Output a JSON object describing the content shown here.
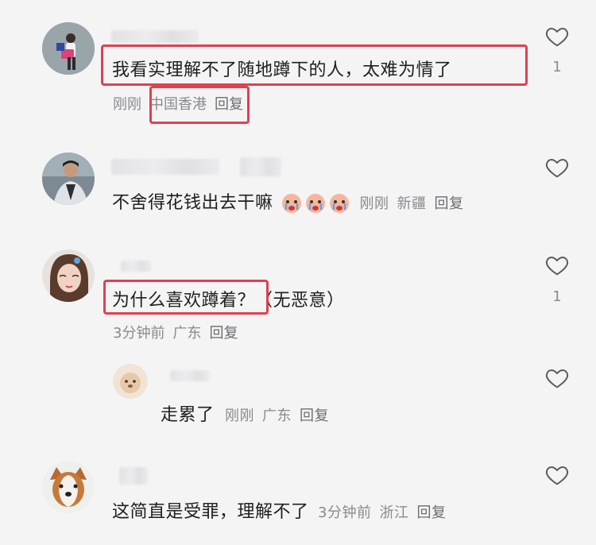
{
  "colors": {
    "background": "#f4f4f5",
    "highlight": "#e0404f",
    "meta_text": "#8a8a8f"
  },
  "comments": [
    {
      "text": "我看实理解不了随地蹲下的人，太难为情了",
      "time": "刚刚",
      "location": "中国香港",
      "reply": "回复",
      "likes": "1",
      "icon": "heart-outline-icon"
    },
    {
      "text": "不舍得花钱出去干嘛",
      "time": "刚刚",
      "location": "新疆",
      "reply": "回复",
      "icon": "heart-outline-icon",
      "emoji": "crying-face-emoji"
    },
    {
      "text": "为什么喜欢蹲着？（无恶意）",
      "time": "3分钟前",
      "location": "广东",
      "reply": "回复",
      "likes": "1",
      "icon": "heart-outline-icon"
    },
    {
      "text": "走累了",
      "time": "刚刚",
      "location": "广东",
      "reply": "回复",
      "icon": "heart-outline-icon"
    },
    {
      "text": "这简直是受罪，理解不了",
      "time": "3分钟前",
      "location": "浙江",
      "reply": "回复",
      "icon": "heart-outline-icon"
    }
  ]
}
